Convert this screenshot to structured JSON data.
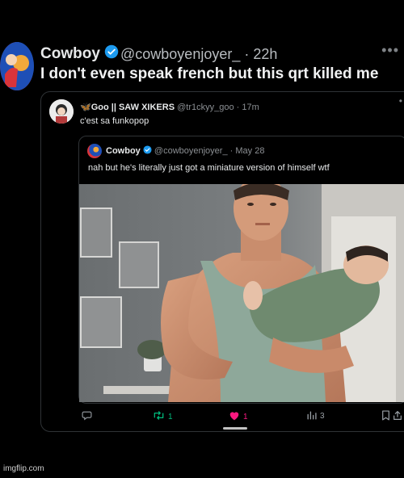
{
  "outer_tweet": {
    "display_name": "Cowboy",
    "handle": "@cowboyenjoyer_",
    "time": "22h",
    "text": "I don't even speak french but this qrt killed me"
  },
  "quote_tweet": {
    "display_name": "🦋Goo || SAW XIKERS",
    "handle": "@tr1ckyy_goo",
    "time": "17m",
    "text": "c'est sa funkopop"
  },
  "nested_tweet": {
    "display_name": "Cowboy",
    "handle": "@cowboyenjoyer_",
    "time": "May 28",
    "text": "nah but he's literally just got a miniature version of himself wtf"
  },
  "actions": {
    "retweets": "1",
    "likes": "1",
    "views": "3"
  },
  "watermark": "imgflip.com",
  "colors": {
    "verified": "#1d9bf0",
    "retweet": "#00ba7c",
    "like": "#f91880"
  },
  "icons": [
    "reply-icon",
    "retweet-icon",
    "like-icon",
    "views-icon",
    "bookmark-icon",
    "share-icon",
    "more-icon",
    "verified-icon"
  ]
}
